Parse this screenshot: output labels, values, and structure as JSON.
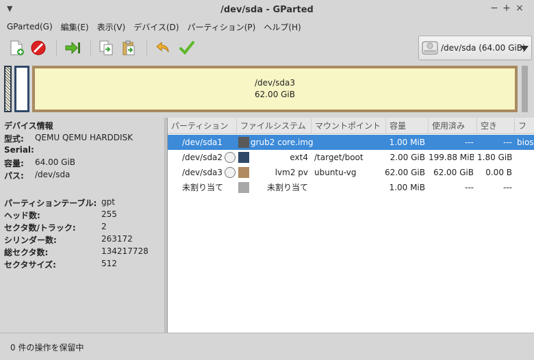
{
  "window": {
    "title": "/dev/sda - GParted",
    "controls": [
      "−",
      "+",
      "×"
    ]
  },
  "menu": [
    "GParted(G)",
    "編集(E)",
    "表示(V)",
    "デバイス(D)",
    "パーティション(P)",
    "ヘルプ(H)"
  ],
  "toolbar": {
    "icons": [
      "new-partition-icon",
      "delete-icon",
      "resize-move-icon",
      "copy-icon",
      "paste-icon",
      "undo-icon",
      "apply-icon"
    ]
  },
  "device_selector": {
    "label": "/dev/sda  (64.00 GiB)"
  },
  "disk_map": {
    "main_partition": {
      "name": "/dev/sda3",
      "size": "62.00 GiB"
    }
  },
  "device_info": {
    "title": "デバイス情報",
    "fields": [
      {
        "key": "型式:",
        "value": "QEMU QEMU HARDDISK"
      },
      {
        "key": "Serial:",
        "value": ""
      },
      {
        "key": "容量:",
        "value": "64.00 GiB"
      },
      {
        "key": "パス:",
        "value": "/dev/sda"
      }
    ],
    "details": [
      {
        "key": "パーティションテーブル:",
        "value": "gpt"
      },
      {
        "key": "ヘッド数:",
        "value": "255"
      },
      {
        "key": "セクタ数/トラック:",
        "value": "2"
      },
      {
        "key": "シリンダー数:",
        "value": "263172"
      },
      {
        "key": "総セクタ数:",
        "value": "134217728"
      },
      {
        "key": "セクタサイズ:",
        "value": "512"
      }
    ]
  },
  "table": {
    "columns": [
      "パーティション",
      "ファイルシステム",
      "マウントポイント",
      "容量",
      "使用済み",
      "空き",
      "フ"
    ],
    "rows": [
      {
        "partition": "/dev/sda1",
        "fs": "grub2 core.img",
        "mount": "",
        "size": "1.00 MiB",
        "used": "---",
        "free": "---",
        "flags": "bios",
        "swatch": "#5a5a5a",
        "locked": false,
        "selected": true
      },
      {
        "partition": "/dev/sda2",
        "fs": "ext4",
        "mount": "/target/boot",
        "size": "2.00 GiB",
        "used": "199.88 MiB",
        "free": "1.80 GiB",
        "flags": "",
        "swatch": "#2f4868",
        "locked": true,
        "selected": false
      },
      {
        "partition": "/dev/sda3",
        "fs": "lvm2 pv",
        "mount": "ubuntu-vg",
        "size": "62.00 GiB",
        "used": "62.00 GiB",
        "free": "0.00 B",
        "flags": "",
        "swatch": "#b08a60",
        "locked": true,
        "selected": false
      },
      {
        "partition": "未割り当て",
        "fs": "未割り当て",
        "mount": "",
        "size": "1.00 MiB",
        "used": "---",
        "free": "---",
        "flags": "",
        "swatch": "#a8a8a8",
        "locked": false,
        "selected": false
      }
    ]
  },
  "status": {
    "text": "0 件の操作を保留中"
  }
}
